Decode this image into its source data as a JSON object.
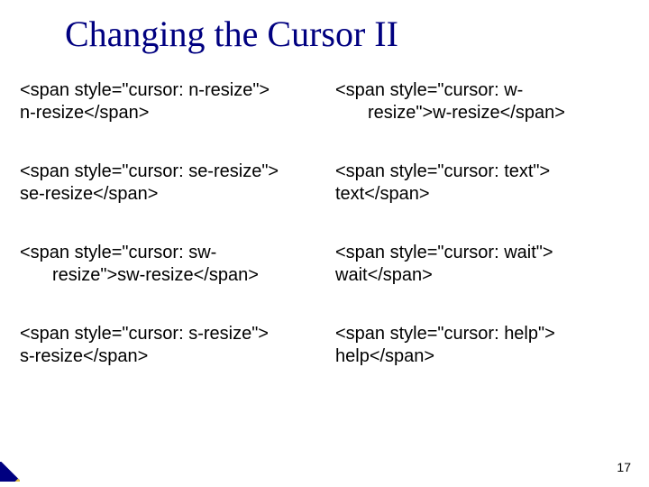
{
  "title": "Changing the Cursor II",
  "left": [
    {
      "l1": "<span style=\"cursor: n-resize\">",
      "l2": "n-resize</span>",
      "indent": false
    },
    {
      "l1": "<span style=\"cursor: se-resize\">",
      "l2": "se-resize</span>",
      "indent": false
    },
    {
      "l1": "<span style=\"cursor: sw-",
      "l2": "resize\">sw-resize</span>",
      "indent": true
    },
    {
      "l1": "<span style=\"cursor: s-resize\">",
      "l2": "s-resize</span>",
      "indent": false
    }
  ],
  "right": [
    {
      "l1": "<span style=\"cursor: w-",
      "l2": "resize\">w-resize</span>",
      "indent": true
    },
    {
      "l1": "<span style=\"cursor: text\">",
      "l2": "text</span>",
      "indent": false
    },
    {
      "l1": "<span style=\"cursor: wait\">",
      "l2": "wait</span>",
      "indent": false
    },
    {
      "l1": "<span style=\"cursor: help\">",
      "l2": "help</span>",
      "indent": false
    }
  ],
  "page_number": "17"
}
